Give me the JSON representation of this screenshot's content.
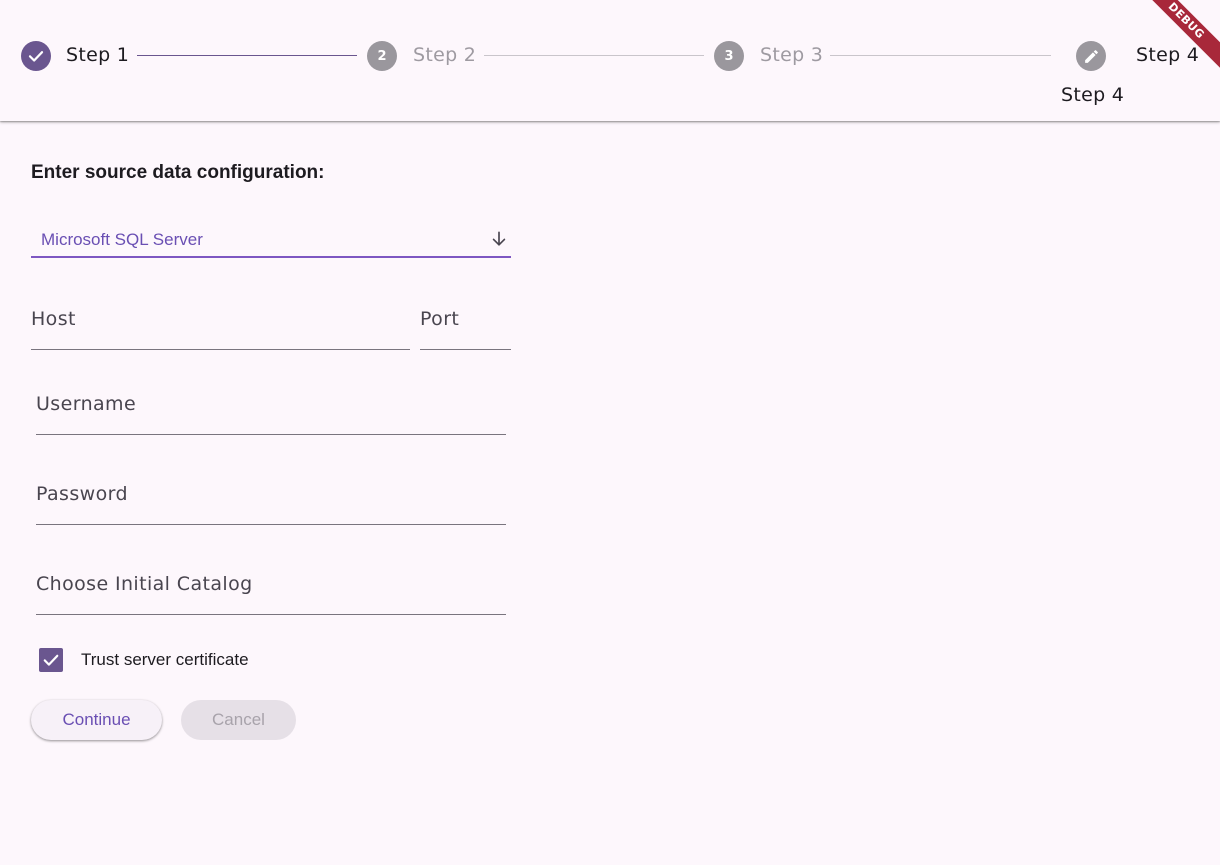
{
  "stepper": {
    "steps": [
      {
        "label": "Step 1",
        "state": "complete",
        "icon": "check-icon"
      },
      {
        "label": "Step 2",
        "state": "inactive",
        "number": "2"
      },
      {
        "label": "Step 3",
        "state": "inactive",
        "number": "3"
      },
      {
        "label": "Step 4",
        "state": "editing",
        "icon": "pencil-icon",
        "sublabel": "Step 4"
      }
    ]
  },
  "debug_banner": "DEBUG",
  "form": {
    "heading": "Enter source data configuration:",
    "source_type": {
      "value": "Microsoft SQL Server",
      "icon": "arrow-down-icon"
    },
    "host_placeholder": "Host",
    "port_placeholder": "Port",
    "username_placeholder": "Username",
    "password_placeholder": "Password",
    "catalog_placeholder": "Choose Initial Catalog",
    "trust_certificate": {
      "label": "Trust server certificate",
      "checked": true
    },
    "continue_label": "Continue",
    "cancel_label": "Cancel"
  },
  "colors": {
    "accent": "#6a568f",
    "primary_text": "#6a4fb3",
    "background": "#fdf7fc",
    "inactive": "#9a979d",
    "debug_ribbon": "#a8283a"
  }
}
